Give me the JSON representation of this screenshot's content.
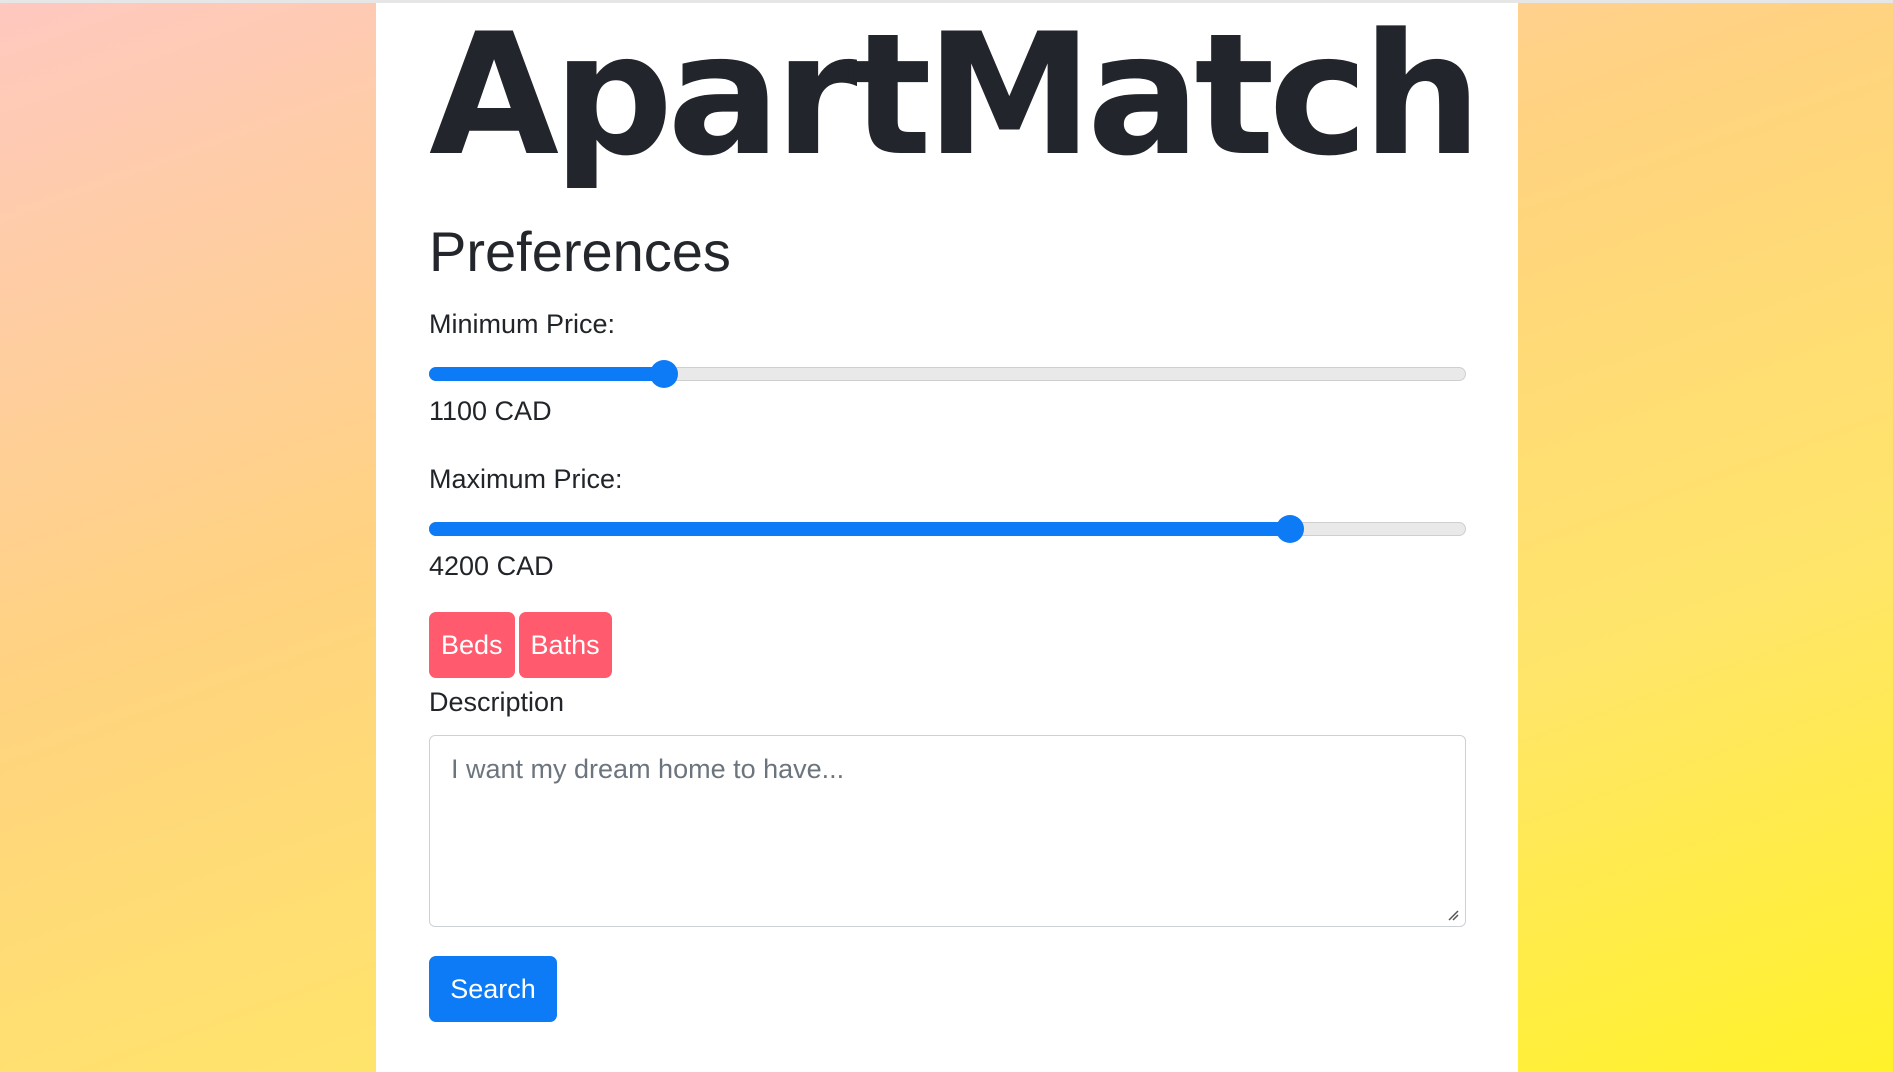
{
  "app": {
    "logo_text": "ApartMatch"
  },
  "preferences": {
    "title": "Preferences",
    "min_price": {
      "label": "Minimum Price:",
      "value_text": "1100 CAD",
      "level": 0.227
    },
    "max_price": {
      "label": "Maximum Price:",
      "value_text": "4200 CAD",
      "level": 0.83
    },
    "filters": [
      {
        "label": "Beds"
      },
      {
        "label": "Baths"
      }
    ],
    "description": {
      "label": "Description",
      "placeholder": "I want my dream home to have..."
    },
    "search_label": "Search"
  },
  "colors": {
    "accent": "#0d7bf6",
    "pill": "#ff5a6e",
    "text": "#212529"
  }
}
